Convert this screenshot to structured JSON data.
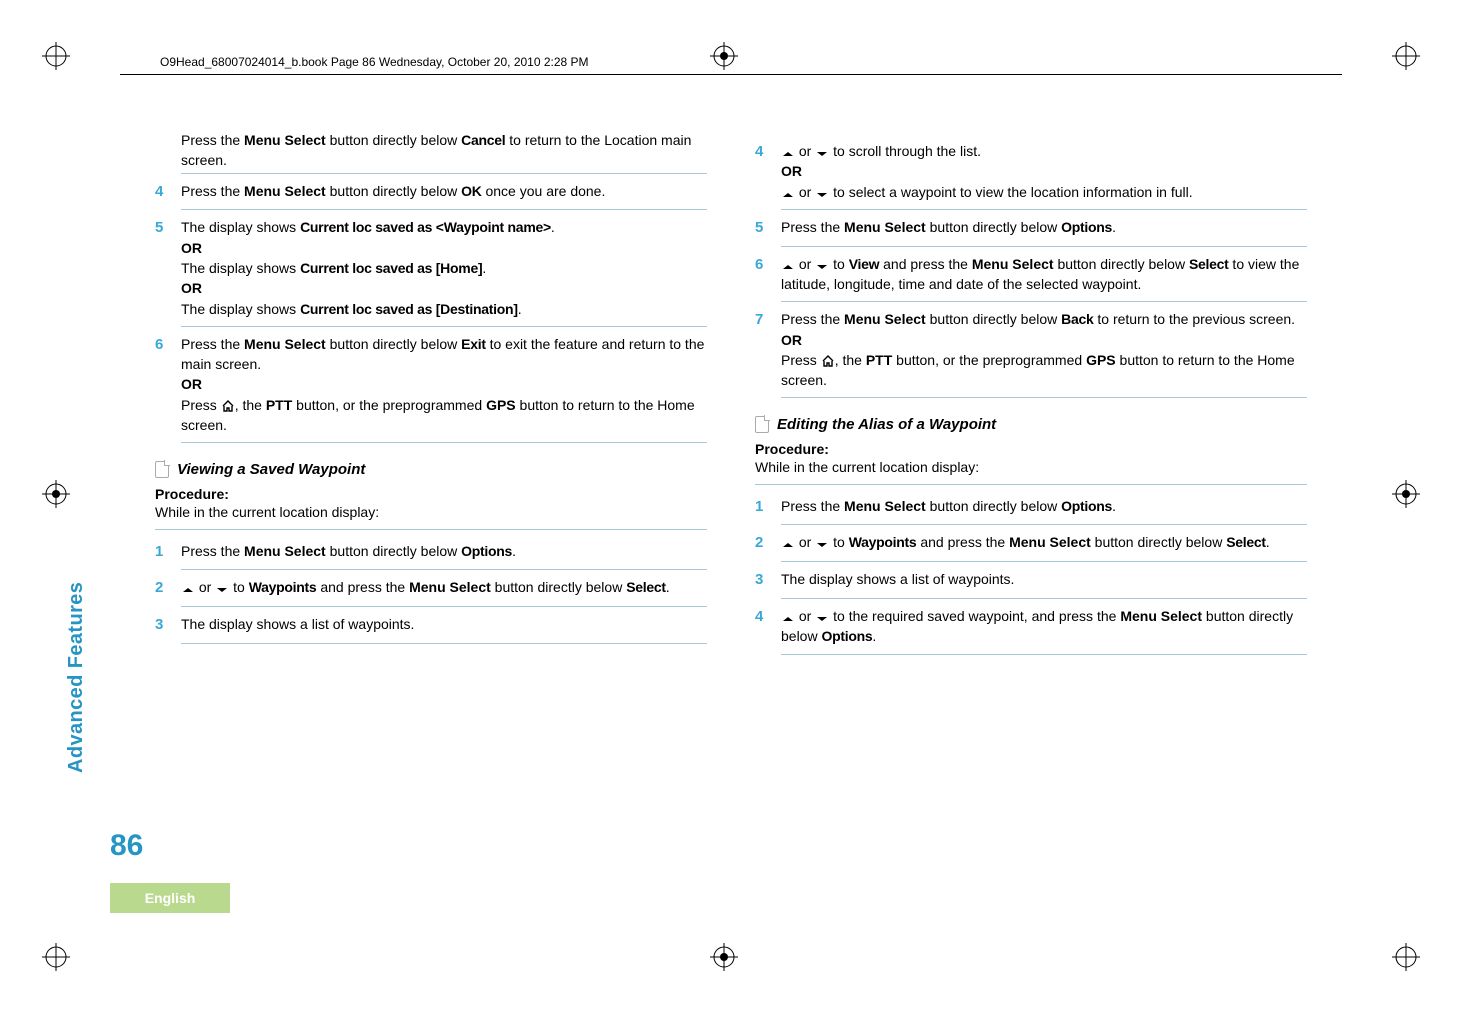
{
  "header": "O9Head_68007024014_b.book  Page 86  Wednesday, October 20, 2010  2:28 PM",
  "page_number": "86",
  "side_label": "Advanced Features",
  "language": "English",
  "left": {
    "intro": {
      "t1a": "Press the ",
      "btn1": "Menu Select",
      "t1b": " button directly below ",
      "d1": "Cancel",
      "t1c": " to return to the Location main screen."
    },
    "s4": {
      "num": "4",
      "a": "Press the ",
      "btn": "Menu Select",
      "b": " button directly below ",
      "d": "OK",
      "c": " once you are done."
    },
    "s5": {
      "num": "5",
      "l1a": "The display shows ",
      "d1": "Current loc saved as <Waypoint name>",
      "dot": ".",
      "or1": "OR",
      "l2a": "The display shows ",
      "d2": "Current loc saved as [Home]",
      "or2": "OR",
      "l3a": "The display shows ",
      "d3": "Current loc saved as [Destination]"
    },
    "s6": {
      "num": "6",
      "a": "Press the ",
      "btn": "Menu Select",
      "b": " button directly below ",
      "d": "Exit",
      "c": " to exit the feature and return to the main screen.",
      "or": "OR",
      "p2a": "Press ",
      "p2b": ", the ",
      "ptt": "PTT",
      "p2c": " button, or the preprogrammed ",
      "gps": "GPS",
      "p2d": " button to return to the Home screen."
    },
    "sub1": "Viewing a Saved Waypoint",
    "proc": "Procedure:",
    "proc_note": "While in the current location display:",
    "v1": {
      "num": "1",
      "a": "Press the ",
      "btn": "Menu Select",
      "b": " button directly below ",
      "d": "Options",
      "dot": "."
    },
    "v2": {
      "num": "2",
      "mid": " to ",
      "d": "Waypoints",
      "a2": " and press the ",
      "btn": "Menu Select",
      "b2": " button directly below ",
      "d2": "Select",
      "dot": "."
    },
    "v3": {
      "num": "3",
      "t": "The display shows a list of waypoints."
    }
  },
  "right": {
    "r4": {
      "num": "4",
      "a": " to scroll through the list.",
      "or": "OR",
      "b": " to select a waypoint to view the location information in full."
    },
    "r5": {
      "num": "5",
      "a": "Press the ",
      "btn": "Menu Select",
      "b": " button directly below ",
      "d": "Options",
      "dot": "."
    },
    "r6": {
      "num": "6",
      "mid": " to ",
      "d": "View",
      "a2": " and press the ",
      "btn": "Menu Select",
      "b2": " button directly below ",
      "d2": "Select",
      "c": " to view the latitude, longitude, time and date of the selected waypoint."
    },
    "r7": {
      "num": "7",
      "a": "Press the ",
      "btn": "Menu Select",
      "b": " button directly below ",
      "d": "Back",
      "c": " to return to the previous screen.",
      "or": "OR",
      "p2a": "Press ",
      "p2b": ", the ",
      "ptt": "PTT",
      "p2c": " button, or the preprogrammed ",
      "gps": "GPS",
      "p2d": " button to return to the Home screen."
    },
    "sub2": "Editing the Alias of a Waypoint",
    "proc": "Procedure:",
    "proc_note": "While in the current location display:",
    "e1": {
      "num": "1",
      "a": "Press the ",
      "btn": "Menu Select",
      "b": " button directly below ",
      "d": "Options",
      "dot": "."
    },
    "e2": {
      "num": "2",
      "mid": " to ",
      "d": "Waypoints",
      "a2": " and press the ",
      "btn": "Menu Select",
      "b2": " button directly below ",
      "d2": "Select",
      "dot": "."
    },
    "e3": {
      "num": "3",
      "t": "The display shows a list of waypoints."
    },
    "e4": {
      "num": "4",
      "a": " to the required saved waypoint, and press the ",
      "btn": "Menu Select",
      "b": " button directly below ",
      "d": "Options",
      "dot": "."
    },
    "or_word": " or "
  }
}
